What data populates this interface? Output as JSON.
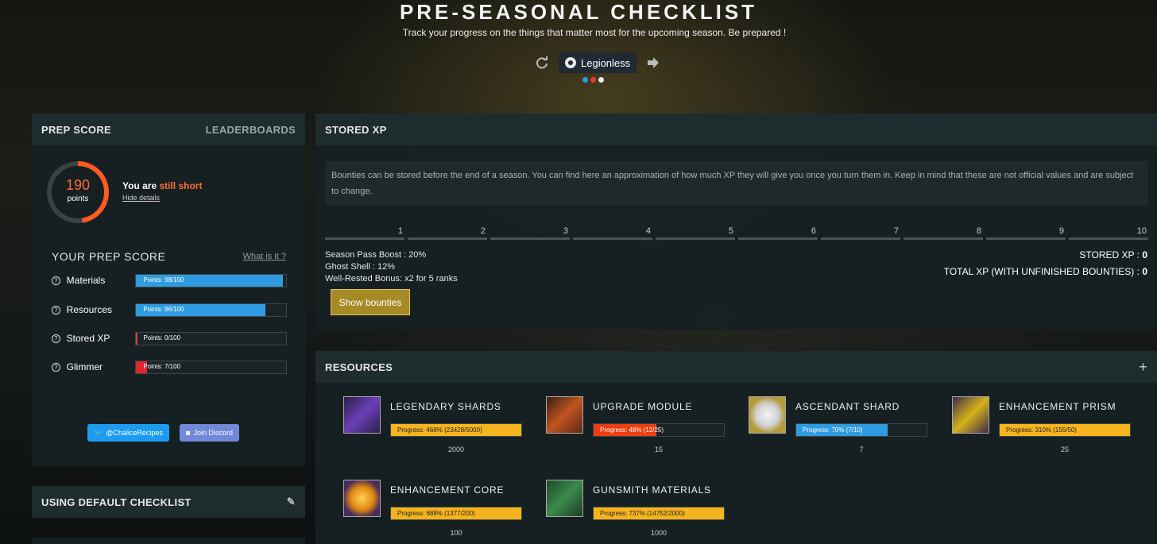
{
  "header": {
    "title": "PRE-SEASONAL CHECKLIST",
    "subtitle": "Track your progress on the things that matter most for the upcoming season. Be prepared !",
    "username": "Legionless",
    "refresh_icon": "refresh-icon",
    "logout_icon": "logout-icon"
  },
  "prep_score": {
    "heading": "PREP SCORE",
    "leaderboards": "LEADERBOARDS",
    "points": "190",
    "points_label": "points",
    "status_prefix": "You are ",
    "status_accent": "still short",
    "hide_details": "Hide details",
    "your_title": "YOUR PREP SCORE",
    "what_is_it": "What is it ?",
    "rows": [
      {
        "label": "Materials",
        "text": "Points: 98/100",
        "fraction": 0.98,
        "color": "#2f9be0"
      },
      {
        "label": "Resources",
        "text": "Points: 86/100",
        "fraction": 0.86,
        "color": "#2f9be0"
      },
      {
        "label": "Stored XP",
        "text": "Points: 0/100",
        "fraction": 0.0,
        "color": "#e23a3a"
      },
      {
        "label": "Glimmer",
        "text": "Points: 7/100",
        "fraction": 0.07,
        "color": "#e2262e"
      }
    ],
    "twitter": "@ChaliceRecipes",
    "discord": "Join Discord"
  },
  "checklist": {
    "heading": "USING DEFAULT CHECKLIST"
  },
  "stored_xp": {
    "heading": "STORED XP",
    "note": "Bounties can be stored before the end of a season. You can find here an approximation of how much XP they will give you once you turn them in. Keep in mind that these are not official values and are subject to change.",
    "ranks": [
      "1",
      "2",
      "3",
      "4",
      "5",
      "6",
      "7",
      "8",
      "9",
      "10"
    ],
    "boost_1": "Season Pass Boost : 20%",
    "boost_2": "Ghost Shell : 12%",
    "boost_3": "Well-Rested Bonus: x2 for 5 ranks",
    "stored_label": "STORED XP : ",
    "stored_value": "0",
    "total_label": "TOTAL XP (WITH UNFINISHED BOUNTIES) : ",
    "total_value": "0",
    "show_bounties": "Show bounties"
  },
  "resources": {
    "heading": "RESOURCES",
    "add_icon": "plus-icon",
    "items": [
      {
        "name": "LEGENDARY SHARDS",
        "progress": "Progress: 468% (23428/5000)",
        "fraction": 1.0,
        "color": "#f5b41e",
        "goal": "2000"
      },
      {
        "name": "UPGRADE MODULE",
        "progress": "Progress: 48% (12/25)",
        "fraction": 0.48,
        "color": "#ee3d12",
        "goal": "15"
      },
      {
        "name": "ASCENDANT SHARD",
        "progress": "Progress: 70% (7/10)",
        "fraction": 0.7,
        "color": "#2f9be0",
        "goal": "7"
      },
      {
        "name": "ENHANCEMENT PRISM",
        "progress": "Progress: 310% (155/50)",
        "fraction": 1.0,
        "color": "#f5b41e",
        "goal": "25"
      },
      {
        "name": "ENHANCEMENT CORE",
        "progress": "Progress: 688% (1377/200)",
        "fraction": 1.0,
        "color": "#f5b41e",
        "goal": "100"
      },
      {
        "name": "GUNSMITH MATERIALS",
        "progress": "Progress: 737% (14752/2000)",
        "fraction": 1.0,
        "color": "#f5b41e",
        "goal": "1000"
      }
    ]
  }
}
